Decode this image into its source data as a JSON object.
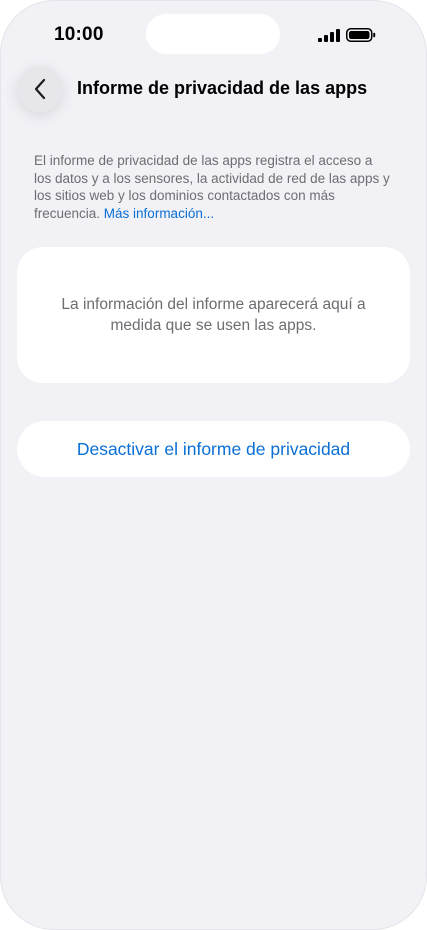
{
  "status_bar": {
    "time": "10:00",
    "signal_icon": "cellular-signal-icon",
    "battery_icon": "battery-icon"
  },
  "nav": {
    "back_icon": "chevron-left-icon",
    "title": "Informe de privacidad de las apps"
  },
  "description": {
    "text": "El informe de privacidad de las apps registra el acceso a los datos y a los sensores, la actividad de red de las apps y los sitios web y los dominios contactados con más frecuencia. ",
    "link_label": "Más información..."
  },
  "info_card": {
    "text": "La información del informe aparecerá aquí a medida que se usen las apps."
  },
  "actions": {
    "disable_label": "Desactivar el informe de privacidad"
  },
  "colors": {
    "background": "#f1f1f6",
    "card": "#ffffff",
    "accent": "#0a6fd6",
    "secondary_text": "#6d6d72"
  }
}
